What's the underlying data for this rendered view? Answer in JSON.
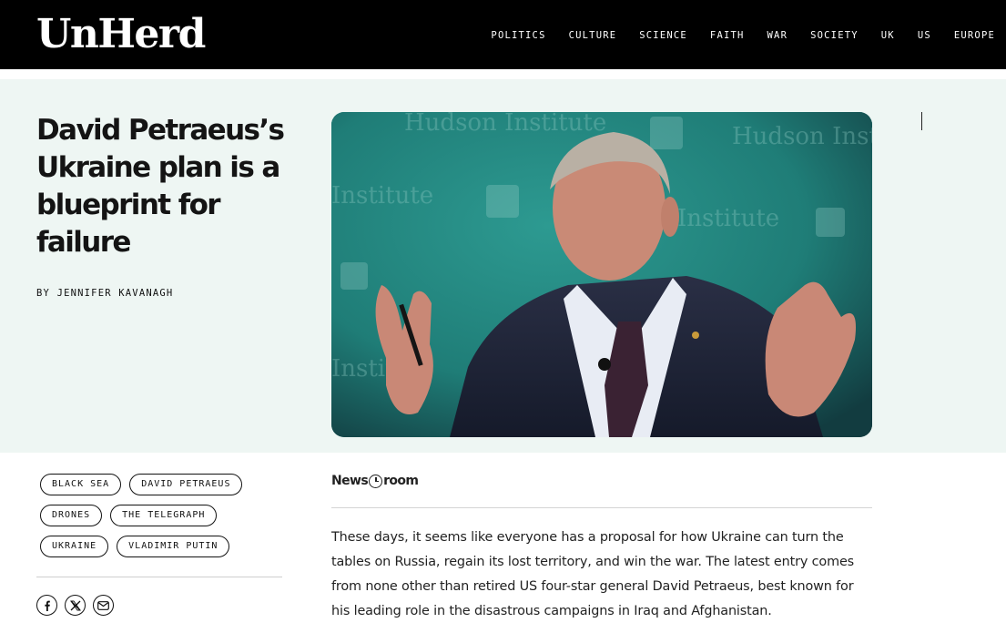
{
  "header": {
    "logo": "UnHerd",
    "nav": [
      "POLITICS",
      "CULTURE",
      "SCIENCE",
      "FAITH",
      "WAR",
      "SOCIETY",
      "UK",
      "US",
      "EUROPE"
    ]
  },
  "article": {
    "headline": "David Petraeus’s Ukraine plan is a blueprint for failure",
    "byline": "BY JENNIFER KAVANAGH",
    "body": "These days, it seems like everyone has a proposal for how Ukraine can turn the tables on Russia, regain its lost territory, and win the war. The latest entry comes from none other than retired US four-star general David Petraeus, best known for his leading role in the disastrous campaigns in Iraq and Afghanistan."
  },
  "hero_image": {
    "background_text": [
      "Hudson Institute",
      "Hudson Institute",
      "Institute",
      "Institute",
      "Institute"
    ]
  },
  "tags": [
    [
      "BLACK SEA",
      "DAVID PETRAEUS"
    ],
    [
      "DRONES",
      "THE TELEGRAPH"
    ],
    [
      "UKRAINE",
      "VLADIMIR PUTIN"
    ]
  ],
  "share": [
    "facebook-icon",
    "x-icon",
    "email-icon"
  ],
  "newsroom": {
    "left": "News",
    "right": "room"
  },
  "colors": {
    "header_bg": "#000000",
    "hero_bg": "#eef6f3",
    "image_teal": "#1f7d77"
  }
}
